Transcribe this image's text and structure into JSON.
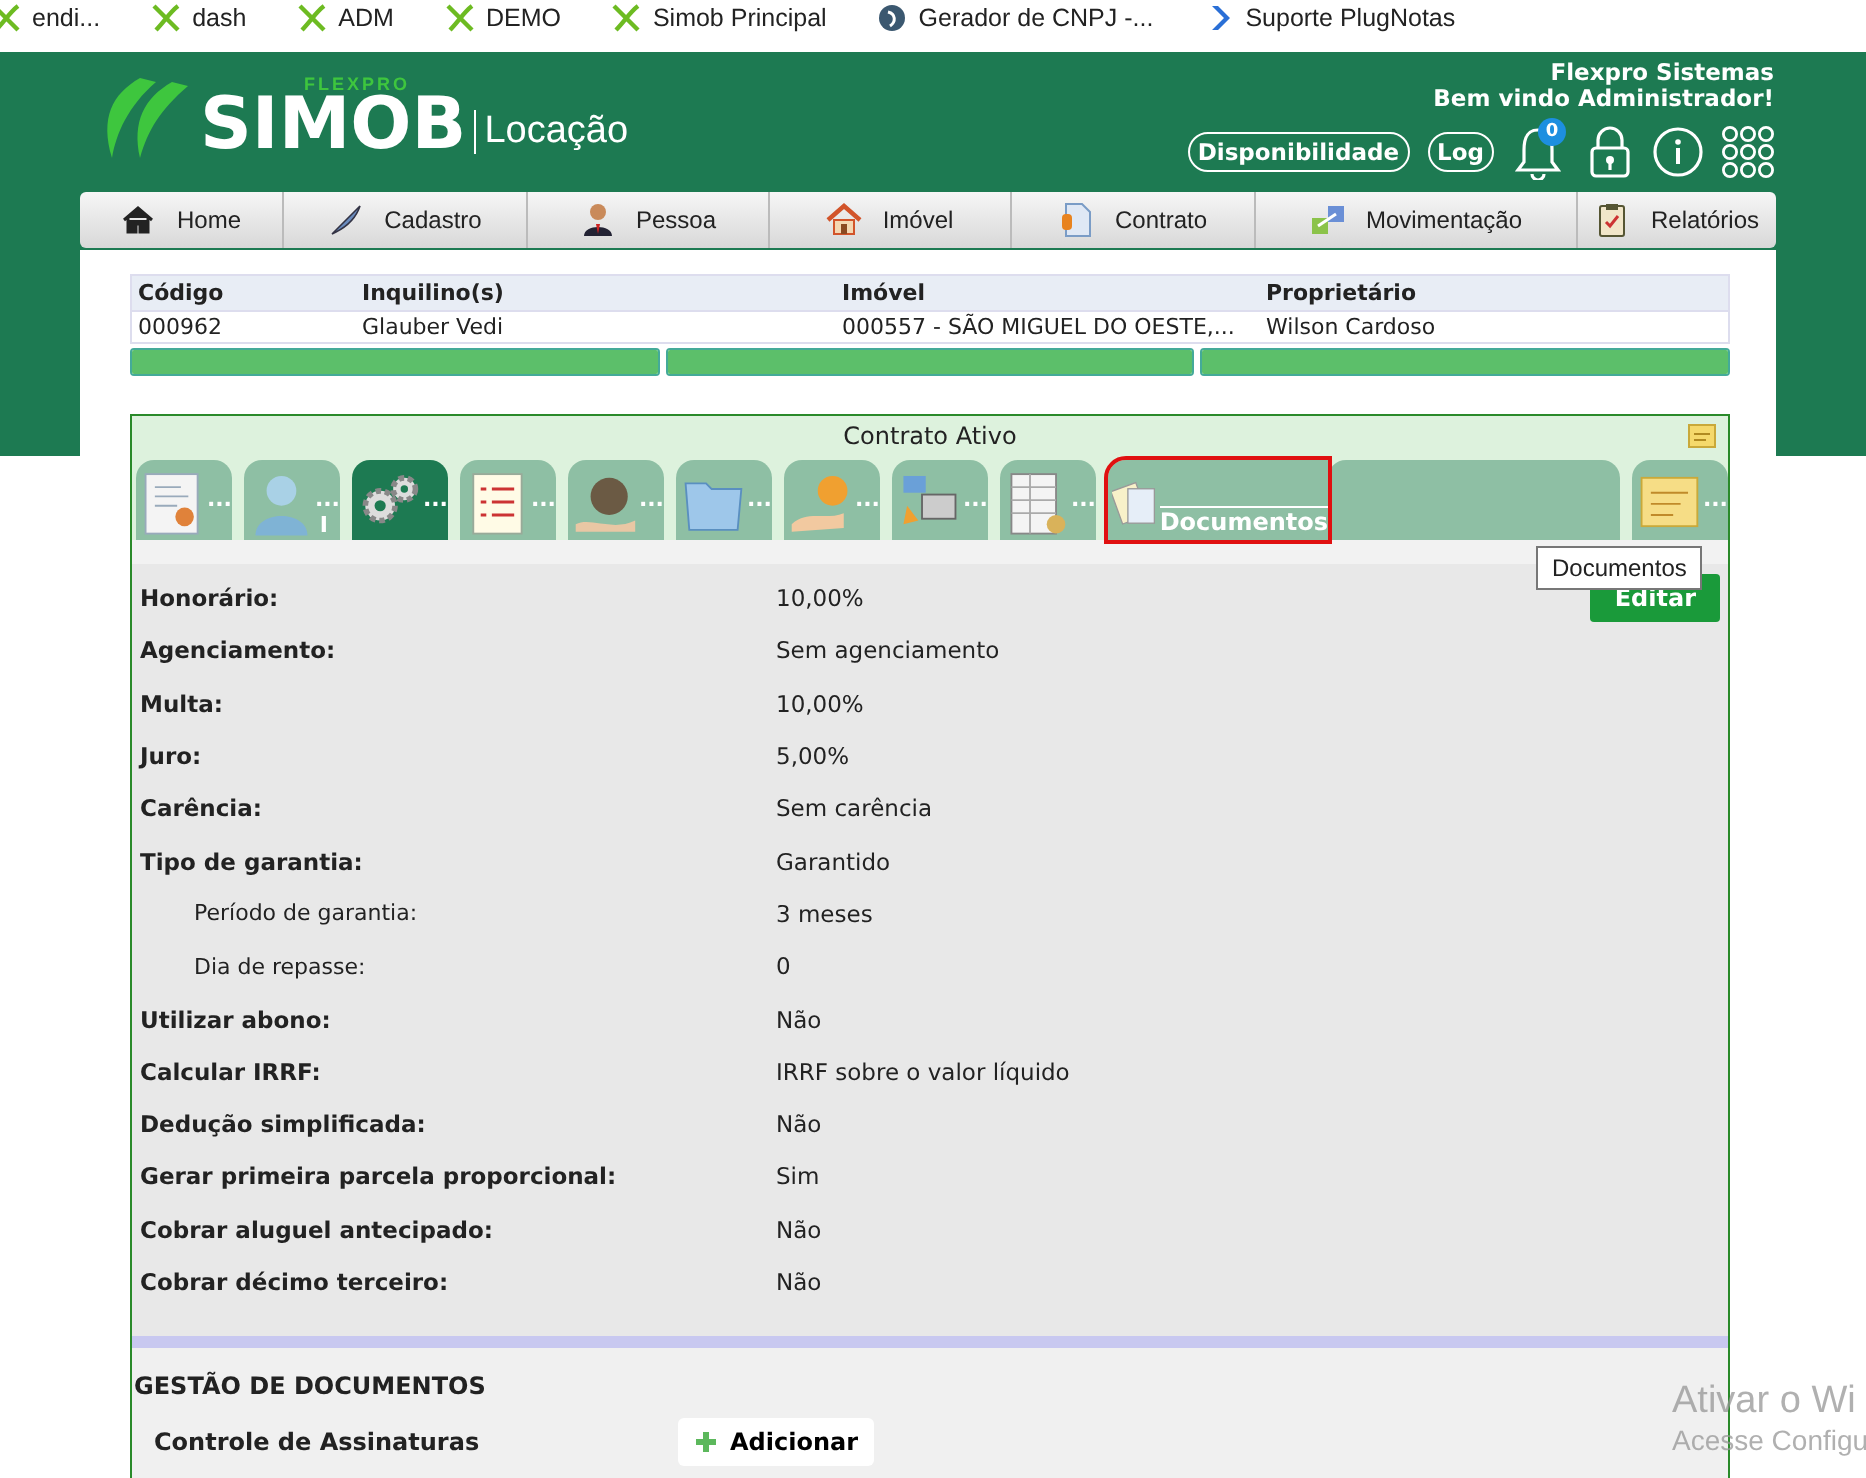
{
  "bookmarks": [
    {
      "kind": "flex",
      "label": "endi..."
    },
    {
      "kind": "flex",
      "label": "dash"
    },
    {
      "kind": "flex",
      "label": "ADM"
    },
    {
      "kind": "flex",
      "label": "DEMO"
    },
    {
      "kind": "flex",
      "label": "Simob Principal"
    },
    {
      "kind": "circle",
      "label": "Gerador de CNPJ -..."
    },
    {
      "kind": "chevron",
      "label": "Suporte PlugNotas"
    }
  ],
  "header": {
    "brand": "FLEXPRO",
    "logo": "SIMOB",
    "module": "Locação",
    "company": "Flexpro Sistemas",
    "welcome": "Bem vindo Administrador!",
    "buttons": [
      "Disponibilidade",
      "Log"
    ],
    "notification_count": "0"
  },
  "nav": [
    {
      "kind": "home",
      "label": "Home"
    },
    {
      "kind": "pen",
      "label": "Cadastro"
    },
    {
      "kind": "person",
      "label": "Pessoa"
    },
    {
      "kind": "house",
      "label": "Imóvel"
    },
    {
      "kind": "doc",
      "label": "Contrato"
    },
    {
      "kind": "arrows",
      "label": "Movimentação"
    },
    {
      "kind": "clipboard",
      "label": "Relatórios"
    }
  ],
  "summary_table": {
    "columns": [
      "Código",
      "Inquilino(s)",
      "Imóvel",
      "Proprietário"
    ],
    "rows": [
      [
        "000962",
        "Glauber Vedi",
        "000557 - SÃO MIGUEL DO OESTE,...",
        "Wilson Cardoso"
      ]
    ],
    "progress_bars": [
      {
        "level": 1
      },
      {
        "level": 1
      },
      {
        "level": 1
      }
    ]
  },
  "contract": {
    "status": "Contrato Ativo",
    "tabs": [
      {
        "kind": "certificate",
        "label": "...",
        "selected": false,
        "hovered": false
      },
      {
        "kind": "person",
        "label": "...",
        "badge": "I",
        "selected": false,
        "hovered": false
      },
      {
        "kind": "gears",
        "label": "...",
        "selected": true,
        "hovered": false
      },
      {
        "kind": "checklist",
        "label": "...",
        "selected": false,
        "hovered": false
      },
      {
        "kind": "money-bag",
        "label": "...",
        "selected": false,
        "hovered": false
      },
      {
        "kind": "folder",
        "label": "...",
        "selected": false,
        "hovered": false
      },
      {
        "kind": "coin-hand",
        "label": "...",
        "selected": false,
        "hovered": false
      },
      {
        "kind": "computer",
        "label": "...",
        "selected": false,
        "hovered": false
      },
      {
        "kind": "spreadsheet",
        "label": "...",
        "selected": false,
        "hovered": false
      },
      {
        "kind": "documents",
        "label": "Documentos",
        "selected": false,
        "hovered": true
      },
      {
        "kind": "note",
        "label": "...",
        "selected": false,
        "hovered": false
      }
    ],
    "tooltip": "Documentos",
    "edit_button": "Editar",
    "fields": [
      {
        "kind": "main",
        "label": "Honorário:",
        "value": "10,00%"
      },
      {
        "kind": "main",
        "label": "Agenciamento:",
        "value": "Sem agenciamento"
      },
      {
        "kind": "main",
        "label": "Multa:",
        "value": "10,00%"
      },
      {
        "kind": "main",
        "label": "Juro:",
        "value": "5,00%"
      },
      {
        "kind": "main",
        "label": "Carência:",
        "value": "Sem carência"
      },
      {
        "kind": "main",
        "label": "Tipo de garantia:",
        "value": "Garantido"
      },
      {
        "kind": "sub",
        "label": "Período de garantia:",
        "value": "3 meses"
      },
      {
        "kind": "sub",
        "label": "Dia de repasse:",
        "value": "0"
      },
      {
        "kind": "main",
        "label": "Utilizar abono:",
        "value": "Não"
      },
      {
        "kind": "main",
        "label": "Calcular IRRF:",
        "value": "IRRF sobre o valor líquido"
      },
      {
        "kind": "main",
        "label": "Dedução simplificada:",
        "value": "Não"
      },
      {
        "kind": "main",
        "label": "Gerar primeira parcela proporcional:",
        "value": "Sim"
      },
      {
        "kind": "main",
        "label": "Cobrar aluguel antecipado:",
        "value": "Não"
      },
      {
        "kind": "main",
        "label": "Cobrar décimo terceiro:",
        "value": "Não"
      }
    ]
  },
  "documents": {
    "title": "GESTÃO DE DOCUMENTOS",
    "rows": [
      {
        "label": "Controle de Assinaturas",
        "button": "Adicionar"
      }
    ]
  },
  "os_notice": [
    "Ativar o Wi",
    "Acesse Configu"
  ]
}
